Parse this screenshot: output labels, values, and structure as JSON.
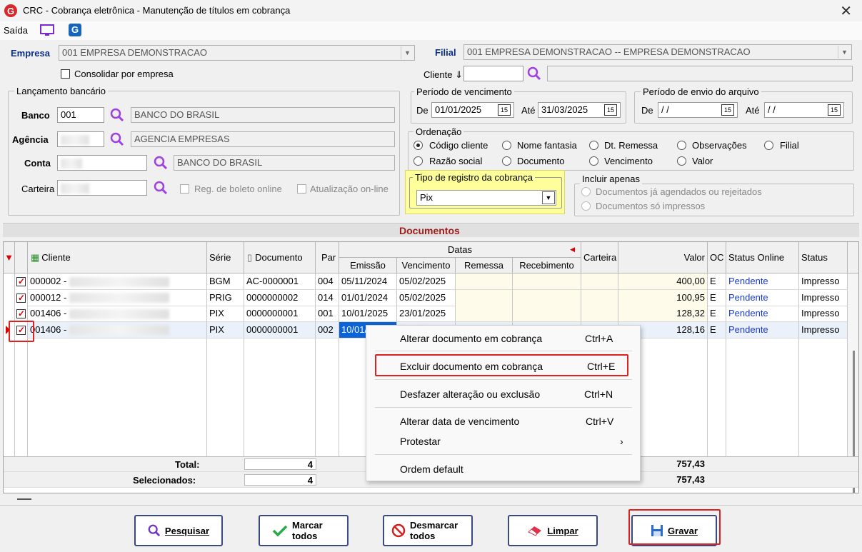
{
  "window": {
    "title": "CRC - Cobrança eletrônica - Manutenção de títulos em cobrança",
    "close": "✕",
    "logo": "G"
  },
  "menu": {
    "saida": "Saída"
  },
  "empresa": {
    "label": "Empresa",
    "value": "001 EMPRESA DEMONSTRACAO",
    "consolidar": "Consolidar por empresa"
  },
  "filial": {
    "label": "Filial",
    "value": "001 EMPRESA DEMONSTRACAO -- EMPRESA DEMONSTRACAO"
  },
  "cliente": {
    "label": "Cliente ⇓",
    "value": "",
    "desc": ""
  },
  "lancamento": {
    "legend": "Lançamento bancário",
    "banco_label": "Banco",
    "banco_code": "001",
    "banco_desc": "BANCO DO BRASIL",
    "agencia_label": "Agência",
    "agencia_desc": "AGENCIA EMPRESAS",
    "conta_label": "Conta",
    "conta_desc": "BANCO DO BRASIL",
    "carteira_label": "Carteira",
    "reg_boleto": "Reg. de boleto online",
    "atualizacao": "Atualização on-line"
  },
  "vencimento": {
    "legend": "Período de vencimento",
    "de_label": "De",
    "de": "01/01/2025",
    "ate_label": "Até",
    "ate": "31/03/2025"
  },
  "envio": {
    "legend": "Período de envio do arquivo",
    "de_label": "De",
    "de": " / /",
    "ate_label": "Até",
    "ate": " / /"
  },
  "ordenacao": {
    "legend": "Ordenação",
    "options": [
      "Código cliente",
      "Nome fantasia",
      "Dt. Remessa",
      "Observações",
      "Filial",
      "Razão social",
      "Documento",
      "Vencimento",
      "Valor"
    ]
  },
  "tipo_registro": {
    "legend": "Tipo de registro da cobrança",
    "value": "Pix"
  },
  "incluir": {
    "legend": "Incluir apenas",
    "opt1": "Documentos já agendados ou rejeitados",
    "opt2": "Documentos só impressos"
  },
  "documentos": {
    "title": "Documentos"
  },
  "columns": {
    "cliente": "Cliente",
    "serie": "Série",
    "documento": "Documento",
    "par": "Par",
    "datas": "Datas",
    "emissao": "Emissão",
    "vencimento": "Vencimento",
    "remessa": "Remessa",
    "recebimento": "Recebimento",
    "carteira": "Carteira",
    "valor": "Valor",
    "oc": "OC",
    "status_online": "Status Online",
    "status": "Status"
  },
  "rows": [
    {
      "cliente": "000002 -",
      "serie": "BGM",
      "documento": "AC-0000001",
      "par": "004",
      "emissao": "05/11/2024",
      "vencimento": "05/02/2025",
      "valor": "400,00",
      "oc": "E",
      "status_online": "Pendente",
      "status": "Impresso"
    },
    {
      "cliente": "000012 -",
      "serie": "PRIG",
      "documento": "0000000002",
      "par": "014",
      "emissao": "01/01/2024",
      "vencimento": "05/02/2025",
      "valor": "100,95",
      "oc": "E",
      "status_online": "Pendente",
      "status": "Impresso"
    },
    {
      "cliente": "001406 -",
      "serie": "PIX",
      "documento": "0000000001",
      "par": "001",
      "emissao": "10/01/2025",
      "vencimento": "23/01/2025",
      "valor": "128,32",
      "oc": "E",
      "status_online": "Pendente",
      "status": "Impresso"
    },
    {
      "cliente": "001406 -",
      "serie": "PIX",
      "documento": "0000000001",
      "par": "002",
      "emissao": "10/01/",
      "vencimento": "",
      "valor": "128,16",
      "oc": "E",
      "status_online": "Pendente",
      "status": "Impresso"
    }
  ],
  "totals": {
    "total_label": "Total:",
    "total_count": "4",
    "total_value": "757,43",
    "sel_label": "Selecionados:",
    "sel_count": "4",
    "sel_value": "757,43"
  },
  "context_menu": {
    "alterar": "Alterar documento em cobrança",
    "alterar_sc": "Ctrl+A",
    "excluir": "Excluir documento em cobrança",
    "excluir_sc": "Ctrl+E",
    "desfazer": "Desfazer alteração ou exclusão",
    "desfazer_sc": "Ctrl+N",
    "alterar_data": "Alterar data de vencimento",
    "alterar_data_sc": "Ctrl+V",
    "protestar": "Protestar",
    "protestar_arrow": "›",
    "ordem": "Ordem default"
  },
  "buttons": {
    "pesquisar": "Pesquisar",
    "marcar": "Marcar todos",
    "desmarcar": "Desmarcar todos",
    "limpar": "Limpar",
    "gravar": "Gravar"
  },
  "colors": {
    "accent_blue": "#0a2f86",
    "highlight": "#d22222",
    "yellow": "#fefe9a"
  }
}
